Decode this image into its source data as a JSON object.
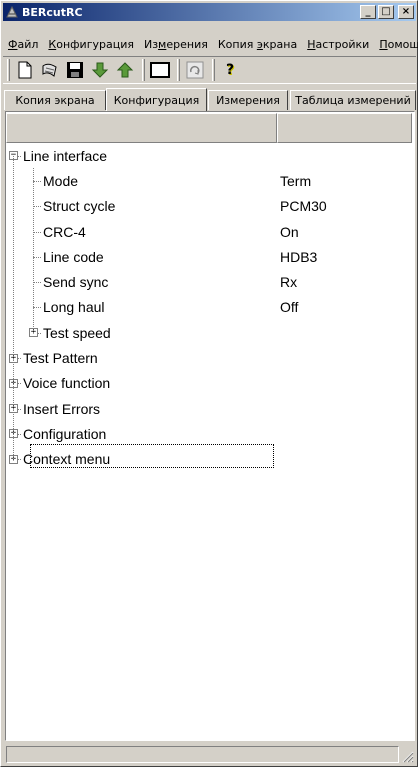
{
  "window": {
    "title": "BERcutRC",
    "buttons": {
      "minimize": "_",
      "maximize": "□",
      "close": "×"
    }
  },
  "menu": [
    {
      "label": "Файл",
      "hotkey": "Ф",
      "rest": "айл"
    },
    {
      "label": "Конфигурация",
      "hotkey": "К",
      "rest": "онфигурация"
    },
    {
      "label": "Измерения",
      "pre": "Из",
      "hotkey": "м",
      "rest": "ерения"
    },
    {
      "label": "Копия экрана",
      "pre": "Копия ",
      "hotkey": "э",
      "rest": "крана"
    },
    {
      "label": "Настройки",
      "hotkey": "Н",
      "rest": "астройки"
    },
    {
      "label": "Помощь",
      "hotkey": "П",
      "rest": "омощь"
    }
  ],
  "toolbar": {
    "buttons": [
      "new-document-icon",
      "open-icon",
      "save-icon",
      "download-icon",
      "upload-icon",
      "screen-icon",
      "refresh-icon",
      "help-icon"
    ],
    "help_label": "?"
  },
  "tabs": [
    {
      "label": "Копия экрана",
      "active": false
    },
    {
      "label": "Конфигурация",
      "active": true
    },
    {
      "label": "Измерения",
      "active": false
    },
    {
      "label": "Таблица измерений",
      "active": false
    }
  ],
  "tree": [
    {
      "name": "Line interface",
      "value": "",
      "level": 0,
      "expander": "−"
    },
    {
      "name": "Mode",
      "value": "Term",
      "level": 1
    },
    {
      "name": "Struct cycle",
      "value": "PCM30",
      "level": 1
    },
    {
      "name": "CRC-4",
      "value": "On",
      "level": 1
    },
    {
      "name": "Line code",
      "value": "HDB3",
      "level": 1
    },
    {
      "name": "Send sync",
      "value": "Rx",
      "level": 1
    },
    {
      "name": "Long haul",
      "value": "Off",
      "level": 1
    },
    {
      "name": "Test speed",
      "value": "",
      "level": 1,
      "expander": "+"
    },
    {
      "name": "Test Pattern",
      "value": "",
      "level": 0,
      "expander": "+"
    },
    {
      "name": "Voice function",
      "value": "",
      "level": 0,
      "expander": "+"
    },
    {
      "name": "Insert Errors",
      "value": "",
      "level": 0,
      "expander": "+"
    },
    {
      "name": "Configuration",
      "value": "",
      "level": 0,
      "expander": "+"
    },
    {
      "name": "Context menu",
      "value": "",
      "level": 0,
      "expander": "+"
    }
  ],
  "colors": {
    "titlebar_start": "#0a246a",
    "titlebar_end": "#a6caf0",
    "face": "#d4d0c8",
    "panel": "#ffffff"
  }
}
